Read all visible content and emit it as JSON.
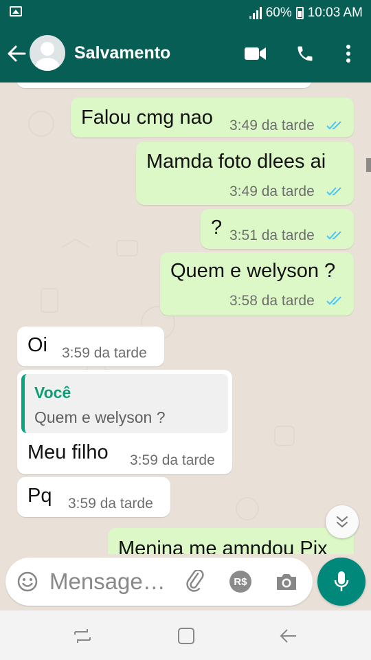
{
  "status_bar": {
    "battery_percent": "60%",
    "clock": "10:03 AM",
    "icons": [
      "image-notification-icon",
      "signal-icon",
      "battery-icon"
    ]
  },
  "header": {
    "contact_name": "Salvamento",
    "icons": [
      "back-arrow-icon",
      "avatar",
      "video-call-icon",
      "phone-icon",
      "more-options-icon"
    ]
  },
  "messages": [
    {
      "direction": "outgoing",
      "text": "Falou cmg nao",
      "time": "3:49 da tarde",
      "status": "read"
    },
    {
      "direction": "outgoing",
      "text": "Mamda foto dlees ai",
      "time": "3:49 da tarde",
      "status": "read"
    },
    {
      "direction": "outgoing",
      "text": "?",
      "time": "3:51 da tarde",
      "status": "read"
    },
    {
      "direction": "outgoing",
      "text": "Quem e welyson ?",
      "time": "3:58 da tarde",
      "status": "read"
    },
    {
      "direction": "incoming",
      "text": "Oi",
      "time": "3:59 da tarde"
    },
    {
      "direction": "incoming",
      "reply_author": "Você",
      "reply_text": "Quem e welyson ?",
      "text": "Meu filho",
      "time": "3:59 da tarde"
    },
    {
      "direction": "incoming",
      "text": "Pq",
      "time": "3:59 da tarde"
    },
    {
      "direction": "outgoing",
      "text": "Menina me amndou Pix"
    }
  ],
  "composer": {
    "placeholder": "Mensage…",
    "icons": [
      "emoji-icon",
      "attach-icon",
      "pix-payment-icon",
      "camera-icon",
      "mic-icon"
    ],
    "pix_label": "R$"
  },
  "navigation": {
    "icons": [
      "recent-apps-icon",
      "home-icon",
      "back-icon"
    ]
  },
  "colors": {
    "header": "#075e54",
    "outgoing_bubble": "#dcf8c6",
    "incoming_bubble": "#ffffff",
    "read_ticks": "#4fc3f7",
    "reply_accent": "#06a77d",
    "chat_background": "#e9e1d8",
    "mic_button": "#00897b"
  }
}
